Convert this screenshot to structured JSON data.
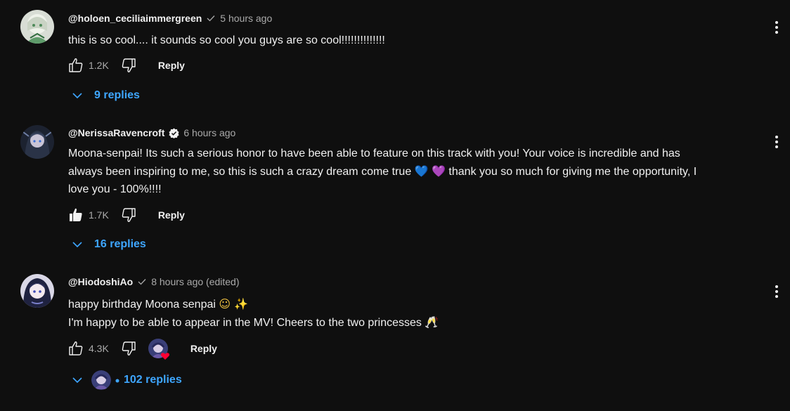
{
  "comments": [
    {
      "author": "@holoen_ceciliaimmergreen",
      "time": "5 hours ago",
      "avatar_icon": "avatar-cecilia",
      "body": [
        "this is so cool.... it sounds so cool you guys are so cool!!!!!!!!!!!!!!"
      ],
      "likes": "1.2K",
      "reply_label": "Reply",
      "replies_label": "9 replies",
      "liked": false
    },
    {
      "author": "@NerissaRavencroft",
      "time": "6 hours ago",
      "avatar_icon": "avatar-nerissa",
      "body": [
        "Moona-senpai! Its such a serious honor to have been able to feature on this track with you! Your voice is incredible and has",
        "always been inspiring to me, so this is such a crazy dream come true",
        "love you - 100%!!!!"
      ],
      "body_emoji": [
        "💙",
        "💜"
      ],
      "body_after_emoji": "thank you so much for giving me the opportunity, I",
      "likes": "1.7K",
      "reply_label": "Reply",
      "replies_label": "16 replies",
      "liked": true
    },
    {
      "author": "@HiodoshiAo",
      "time": "8 hours ago (edited)",
      "avatar_icon": "avatar-ao",
      "body": [
        "happy birthday Moona senpai",
        "I'm happy to be able to appear in the MV! Cheers to the two princesses"
      ],
      "body_emoji_line1": "☺ ✨",
      "body_emoji_line2": "🥂",
      "likes": "4.3K",
      "reply_label": "Reply",
      "replies_label": "102 replies",
      "liked": false
    }
  ],
  "colors": {
    "background": "#0f0f0f",
    "text": "#f1f1f1",
    "secondary": "#aaaaaa",
    "link": "#3ea6ff",
    "heart": "#ff0033"
  }
}
